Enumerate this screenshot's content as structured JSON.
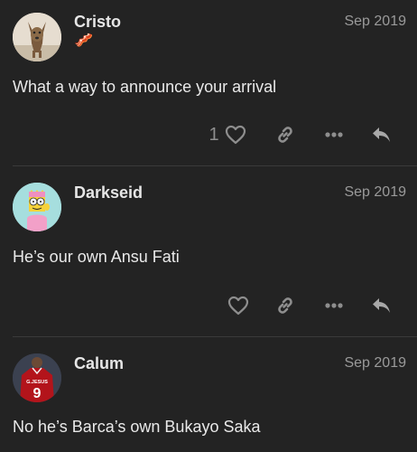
{
  "posts": [
    {
      "username": "Cristo",
      "date": "Sep 2019",
      "flair": "🥓",
      "body": "What a way to announce your arrival",
      "like_count": "1"
    },
    {
      "username": "Darkseid",
      "date": "Sep 2019",
      "body": "He’s our own Ansu Fati",
      "like_count": ""
    },
    {
      "username": "Calum",
      "date": "Sep 2019",
      "body": "No he’s Barca’s own Bukayo Saka",
      "avatar_shirt_text": "G.JESUS",
      "avatar_shirt_number": "9"
    }
  ],
  "icons": {
    "like": "heart-icon",
    "link": "link-icon",
    "more": "ellipsis-icon",
    "reply": "reply-icon"
  },
  "colors": {
    "background": "#232323",
    "text": "#e9e9e9",
    "muted": "#8e8e8e",
    "date": "#9a9a9a"
  }
}
